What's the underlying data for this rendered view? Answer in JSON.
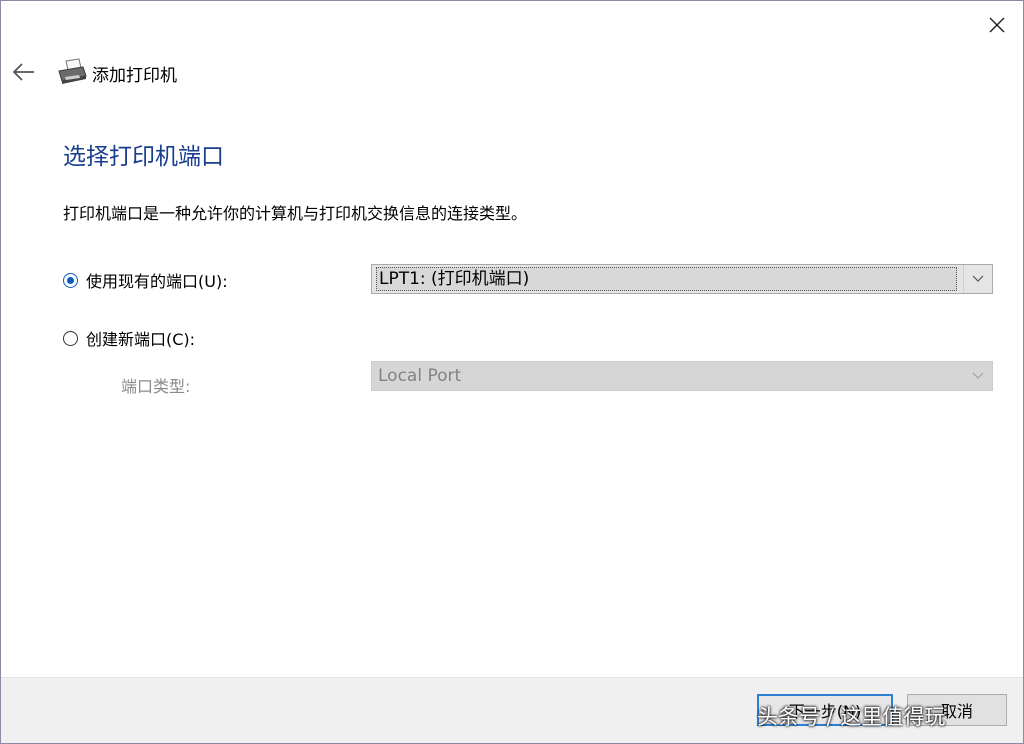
{
  "window": {
    "title": "添加打印机",
    "close_icon": "close-icon",
    "back_icon": "back-arrow-icon",
    "title_icon": "printer-icon"
  },
  "page": {
    "heading": "选择打印机端口",
    "description": "打印机端口是一种允许你的计算机与打印机交换信息的连接类型。"
  },
  "options": {
    "existing_port_label": "使用现有的端口(U):",
    "existing_port_selected": true,
    "existing_port_value": "LPT1: (打印机端口)",
    "new_port_label": "创建新端口(C):",
    "new_port_selected": false,
    "port_type_label": "端口类型:",
    "port_type_value": "Local Port"
  },
  "footer": {
    "next_label": "下一步(N)",
    "cancel_label": "取消"
  },
  "watermark": "头条号 / 这里值得玩",
  "colors": {
    "heading": "#1a3d8f",
    "accent": "#0a5cc0",
    "footer_bg": "#f0f0f0"
  }
}
